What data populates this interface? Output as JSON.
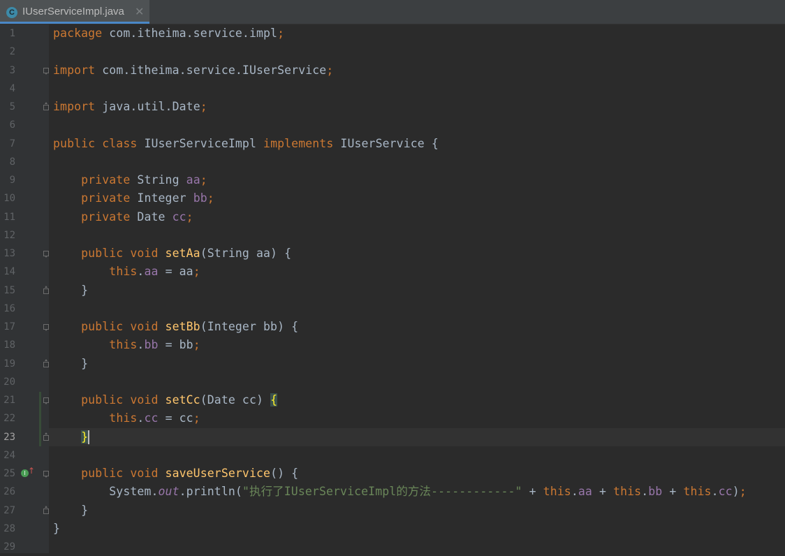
{
  "tab": {
    "icon_letter": "C",
    "filename": "IUserServiceImpl.java",
    "close_glyph": "✕"
  },
  "editor": {
    "active_line": 23,
    "line_numbers": [
      "1",
      "2",
      "3",
      "4",
      "5",
      "6",
      "7",
      "8",
      "9",
      "10",
      "11",
      "12",
      "13",
      "14",
      "15",
      "16",
      "17",
      "18",
      "19",
      "20",
      "21",
      "22",
      "23",
      "24",
      "25",
      "26",
      "27",
      "28",
      "29"
    ],
    "lines": {
      "l1": [
        [
          "kw",
          "package "
        ],
        [
          "plain",
          "com.itheima.service.impl"
        ],
        [
          "kw",
          ";"
        ]
      ],
      "l3": [
        [
          "kw",
          "import "
        ],
        [
          "plain",
          "com.itheima.service.IUserService"
        ],
        [
          "kw",
          ";"
        ]
      ],
      "l5": [
        [
          "kw",
          "import "
        ],
        [
          "plain",
          "java.util.Date"
        ],
        [
          "kw",
          ";"
        ]
      ],
      "l7": [
        [
          "kw",
          "public class "
        ],
        [
          "plain",
          "IUserServiceImpl "
        ],
        [
          "kw",
          "implements "
        ],
        [
          "plain",
          "IUserService {"
        ]
      ],
      "l9": [
        [
          "plain",
          "    "
        ],
        [
          "kw",
          "private "
        ],
        [
          "plain",
          "String "
        ],
        [
          "field",
          "aa"
        ],
        [
          "kw",
          ";"
        ]
      ],
      "l10": [
        [
          "plain",
          "    "
        ],
        [
          "kw",
          "private "
        ],
        [
          "plain",
          "Integer "
        ],
        [
          "field",
          "bb"
        ],
        [
          "kw",
          ";"
        ]
      ],
      "l11": [
        [
          "plain",
          "    "
        ],
        [
          "kw",
          "private "
        ],
        [
          "plain",
          "Date "
        ],
        [
          "field",
          "cc"
        ],
        [
          "kw",
          ";"
        ]
      ],
      "l13": [
        [
          "plain",
          "    "
        ],
        [
          "kw",
          "public void "
        ],
        [
          "method",
          "setAa"
        ],
        [
          "plain",
          "(String aa) {"
        ]
      ],
      "l14": [
        [
          "plain",
          "        "
        ],
        [
          "kw",
          "this"
        ],
        [
          "plain",
          "."
        ],
        [
          "field",
          "aa"
        ],
        [
          "plain",
          " = aa"
        ],
        [
          "kw",
          ";"
        ]
      ],
      "l15": [
        [
          "plain",
          "    }"
        ]
      ],
      "l17": [
        [
          "plain",
          "    "
        ],
        [
          "kw",
          "public void "
        ],
        [
          "method",
          "setBb"
        ],
        [
          "plain",
          "(Integer bb) {"
        ]
      ],
      "l18": [
        [
          "plain",
          "        "
        ],
        [
          "kw",
          "this"
        ],
        [
          "plain",
          "."
        ],
        [
          "field",
          "bb"
        ],
        [
          "plain",
          " = bb"
        ],
        [
          "kw",
          ";"
        ]
      ],
      "l19": [
        [
          "plain",
          "    }"
        ]
      ],
      "l21": [
        [
          "plain",
          "    "
        ],
        [
          "kw",
          "public void "
        ],
        [
          "method",
          "setCc"
        ],
        [
          "plain",
          "(Date cc) "
        ],
        [
          "brace",
          "{"
        ]
      ],
      "l22": [
        [
          "plain",
          "        "
        ],
        [
          "kw",
          "this"
        ],
        [
          "plain",
          "."
        ],
        [
          "field",
          "cc"
        ],
        [
          "plain",
          " = cc"
        ],
        [
          "kw",
          ";"
        ]
      ],
      "l23": [
        [
          "plain",
          "    "
        ],
        [
          "brace",
          "}"
        ],
        [
          "cursor",
          ""
        ]
      ],
      "l25": [
        [
          "plain",
          "    "
        ],
        [
          "kw",
          "public void "
        ],
        [
          "method",
          "saveUserService"
        ],
        [
          "plain",
          "() {"
        ]
      ],
      "l26": [
        [
          "plain",
          "        System."
        ],
        [
          "italic",
          "out"
        ],
        [
          "plain",
          ".println("
        ],
        [
          "str",
          "\"执行了IUserServiceImpl的方法------------\""
        ],
        [
          "plain",
          " + "
        ],
        [
          "kw",
          "this"
        ],
        [
          "plain",
          "."
        ],
        [
          "field",
          "aa"
        ],
        [
          "plain",
          " + "
        ],
        [
          "kw",
          "this"
        ],
        [
          "plain",
          "."
        ],
        [
          "field",
          "bb"
        ],
        [
          "plain",
          " + "
        ],
        [
          "kw",
          "this"
        ],
        [
          "plain",
          "."
        ],
        [
          "field",
          "cc"
        ],
        [
          "plain",
          ")"
        ],
        [
          "kw",
          ";"
        ]
      ],
      "l27": [
        [
          "plain",
          "    }"
        ]
      ],
      "l28": [
        [
          "plain",
          "}"
        ]
      ]
    }
  },
  "colors": {
    "background": "#2b2b2b",
    "keyword": "#cc7832",
    "field": "#9876aa",
    "method": "#ffc66d",
    "string": "#6a8759",
    "text": "#a9b7c6"
  }
}
